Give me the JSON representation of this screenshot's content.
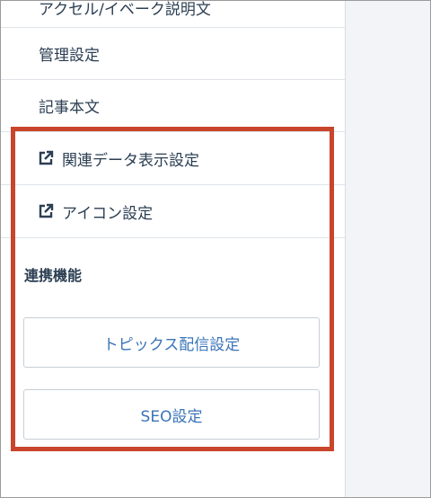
{
  "menu": {
    "cut_item": "アクセル/イベーク説明文",
    "admin_settings": "管理設定",
    "article_body": "記事本文",
    "related_data_display": "関連データ表示設定",
    "icon_settings": "アイコン設定"
  },
  "integration": {
    "title": "連携機能",
    "topics_button": "トピックス配信設定",
    "seo_button": "SEO設定"
  },
  "colors": {
    "highlight": "#c9452b",
    "link_text": "#3a74b8",
    "body_text": "#2b3e52"
  }
}
